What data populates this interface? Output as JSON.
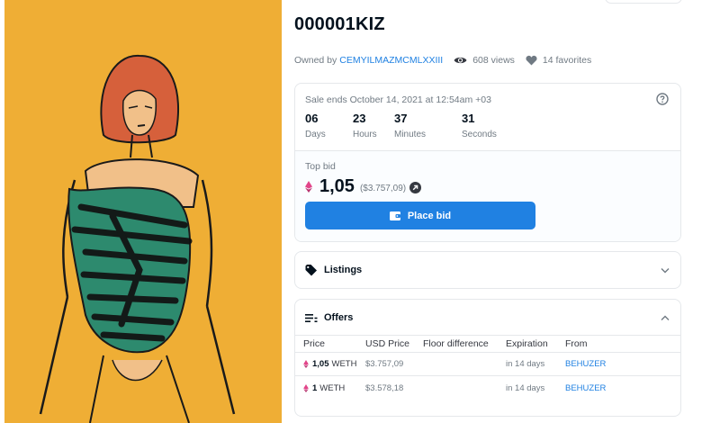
{
  "asset": {
    "title": "000001KIZ",
    "owned_by_label": "Owned by",
    "owner": "CEMYILMAZMCMLXXIII",
    "views": "608 views",
    "favorites": "14 favorites"
  },
  "sale": {
    "ends_text": "Sale ends October 14, 2021 at 12:54am +03",
    "countdown": [
      {
        "value": "06",
        "label": "Days"
      },
      {
        "value": "23",
        "label": "Hours"
      },
      {
        "value": "37",
        "label": "Minutes"
      },
      {
        "value": "31",
        "label": "Seconds"
      }
    ],
    "top_bid_label": "Top bid",
    "top_bid_value": "1,05",
    "top_bid_usd": "($3.757,09)",
    "place_bid_label": "Place bid"
  },
  "listings": {
    "label": "Listings"
  },
  "offers": {
    "label": "Offers",
    "columns": [
      "Price",
      "USD Price",
      "Floor difference",
      "Expiration",
      "From"
    ],
    "rows": [
      {
        "amount": "1,05",
        "currency": "WETH",
        "usd": "$3.757,09",
        "floor": "",
        "expiration": "in 14 days",
        "from": "BEHUZER"
      },
      {
        "amount": "1",
        "currency": "WETH",
        "usd": "$3.578,18",
        "floor": "",
        "expiration": "in 14 days",
        "from": "BEHUZER"
      }
    ]
  },
  "colors": {
    "accent": "#2081e2",
    "artwork_background": "#f2b238",
    "eth_icon": "#e2458a"
  },
  "icons": {
    "views": "eye-icon",
    "favorites": "heart-icon",
    "help": "question-circle-icon",
    "currency": "eth-icon",
    "external": "arrow-up-right-icon",
    "place_bid": "wallet-icon",
    "listings": "tag-icon",
    "offers": "list-icon",
    "listings_toggle": "chevron-down-icon",
    "offers_toggle": "chevron-up-icon"
  }
}
